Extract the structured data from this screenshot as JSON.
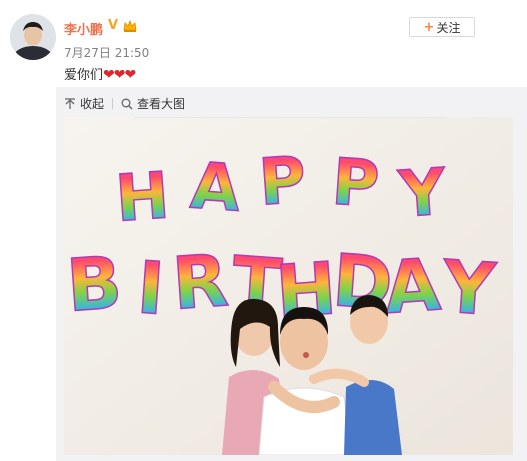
{
  "post": {
    "username": "李小鹏",
    "verified_badge": "V",
    "crown_icon": "crown-icon",
    "timestamp": "7月27日 21:50",
    "content_text": "爱你们",
    "content_emoji": "❤❤❤",
    "follow_label": "关注",
    "follow_icon": "plus-icon"
  },
  "toolbar": {
    "collapse_label": "收起",
    "collapse_icon": "collapse-up-icon",
    "view_large_label": "查看大图",
    "view_large_icon": "magnifier-icon"
  },
  "photo": {
    "banner_line1": [
      "H",
      "A",
      "P",
      "P",
      "Y"
    ],
    "banner_line2": [
      "B",
      "I",
      "R",
      "T",
      "H",
      "D",
      "A",
      "Y"
    ]
  },
  "colors": {
    "username": "#eb7350",
    "follow_plus": "#ff8140",
    "heart": "#e0262d",
    "panel_bg": "#f2f2f5"
  }
}
